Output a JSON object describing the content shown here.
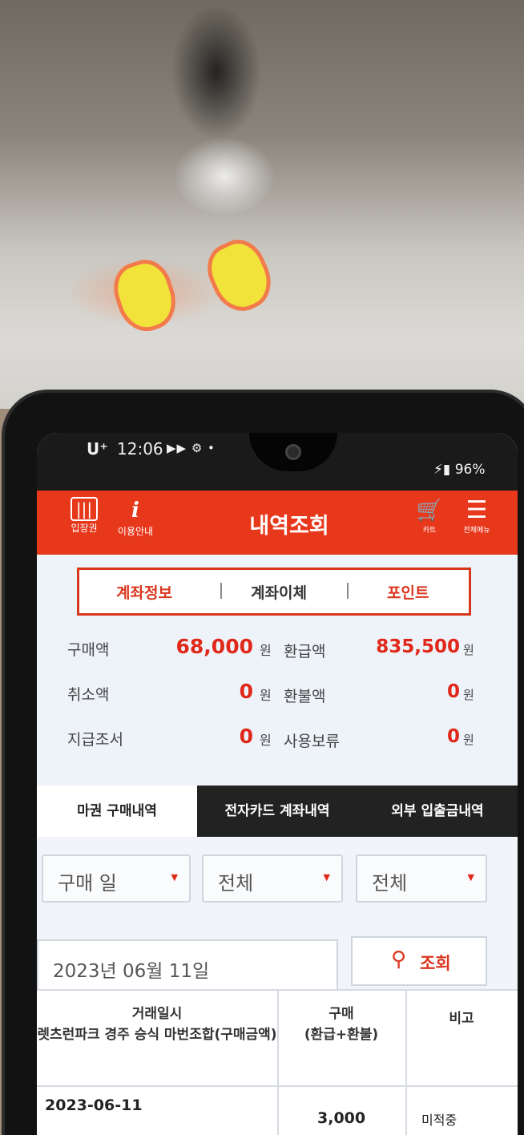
{
  "status_bar": {
    "carrier": "U⁺",
    "time": "12:06",
    "icons": "▶▶ ⚙ •",
    "battery": "96%"
  },
  "app_bar": {
    "title": "내역조회",
    "left_buttons": [
      {
        "label": "입장권",
        "icon": "barcode-icon"
      },
      {
        "label": "이용안내",
        "icon": "info-icon"
      }
    ],
    "right_buttons": [
      {
        "label": "카트",
        "icon": "cart-icon"
      },
      {
        "label": "전체메뉴",
        "icon": "menu-icon"
      }
    ],
    "accent_color": "#e8381c"
  },
  "segment_tabs": [
    "계좌정보",
    "계좌이체",
    "포인트"
  ],
  "account_summary": [
    {
      "label": "구매액",
      "value": "68,000",
      "unit": "원",
      "label2": "환급액",
      "value2": "835,500",
      "unit2": "원"
    },
    {
      "label": "취소액",
      "value": "0",
      "unit": "원",
      "label2": "환불액",
      "value2": "0",
      "unit2": "원"
    },
    {
      "label": "지급조서",
      "value": "0",
      "unit": "원",
      "label2": "사용보류",
      "value2": "0",
      "unit2": "원"
    }
  ],
  "history_tabs": [
    "마권 구매내역",
    "전자카드 계좌내역",
    "외부 입출금내역"
  ],
  "filters": {
    "date_type": "구매 일",
    "filter2": "전체",
    "filter3": "전체",
    "date": "2023년 06월 11일",
    "search_label": "조회"
  },
  "table": {
    "headers": {
      "col1": "거래일시\n렛츠런파크 경주 승식 마번조합(구매금액)",
      "col2": "구매\n(환급+환불)",
      "col3": "비고"
    },
    "rows": [
      {
        "date": "2023-06-11",
        "amount": "3,000",
        "note": "미적중"
      }
    ]
  }
}
